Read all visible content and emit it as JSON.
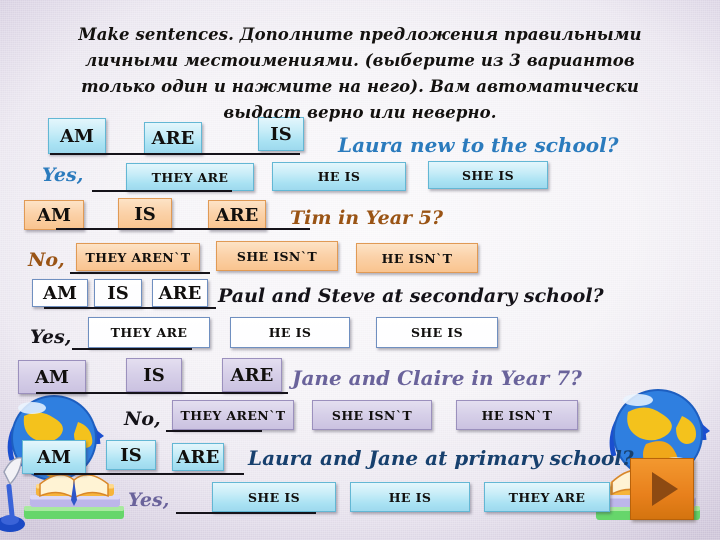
{
  "slide": {
    "title": "Make sentences. Дополните предложения правильными личными местоимениями. (выберите из 3 вариантов только один и нажмите на него). Вам автоматически выдаст верно или неверно.",
    "colors": {
      "row1_accent": "#2b7bbd",
      "row2_accent": "#9a5415",
      "row3_accent": "#141218",
      "row4_accent": "#6a639b",
      "row5_accent": "#17406e",
      "cyan_button": "#a9e2f3",
      "orange_button": "#f9c48f",
      "white_button": "#ffffff",
      "purple_button": "#cbc2e1",
      "play_button": "#e8801c"
    }
  },
  "exercises": [
    {
      "id": "q1",
      "verb_options": [
        "AM",
        "ARE",
        "IS"
      ],
      "question": "Laura new to the school?",
      "lead": "Yes,",
      "answer_options": [
        "THEY ARE",
        "HE IS",
        "SHE IS"
      ]
    },
    {
      "id": "q2",
      "verb_options": [
        "AM",
        "IS",
        "ARE"
      ],
      "question": "Tim in Year 5?",
      "lead": "No,",
      "answer_options": [
        "THEY AREN`T",
        "SHE ISN`T",
        "HE ISN`T"
      ]
    },
    {
      "id": "q3",
      "verb_options": [
        "AM",
        "IS",
        "ARE"
      ],
      "question": "Paul and Steve at secondary school?",
      "lead": "Yes,",
      "answer_options": [
        "THEY ARE",
        "HE IS",
        "SHE IS"
      ]
    },
    {
      "id": "q4",
      "verb_options": [
        "AM",
        "IS",
        "ARE"
      ],
      "question": "Jane and Claire in Year 7?",
      "lead": "No,",
      "answer_options": [
        "THEY AREN`T",
        "SHE ISN`T",
        "HE ISN`T"
      ]
    },
    {
      "id": "q5",
      "verb_options": [
        "AM",
        "IS",
        "ARE"
      ],
      "question": "Laura and Jane at primary school?",
      "lead": "Yes,",
      "answer_options": [
        "SHE IS",
        "HE IS",
        "THEY ARE"
      ]
    }
  ],
  "decorations": {
    "left_clipart": "globe-books-quill-clipart",
    "right_clipart": "globe-books-clipart",
    "play_button_label": "play-next-slide"
  }
}
